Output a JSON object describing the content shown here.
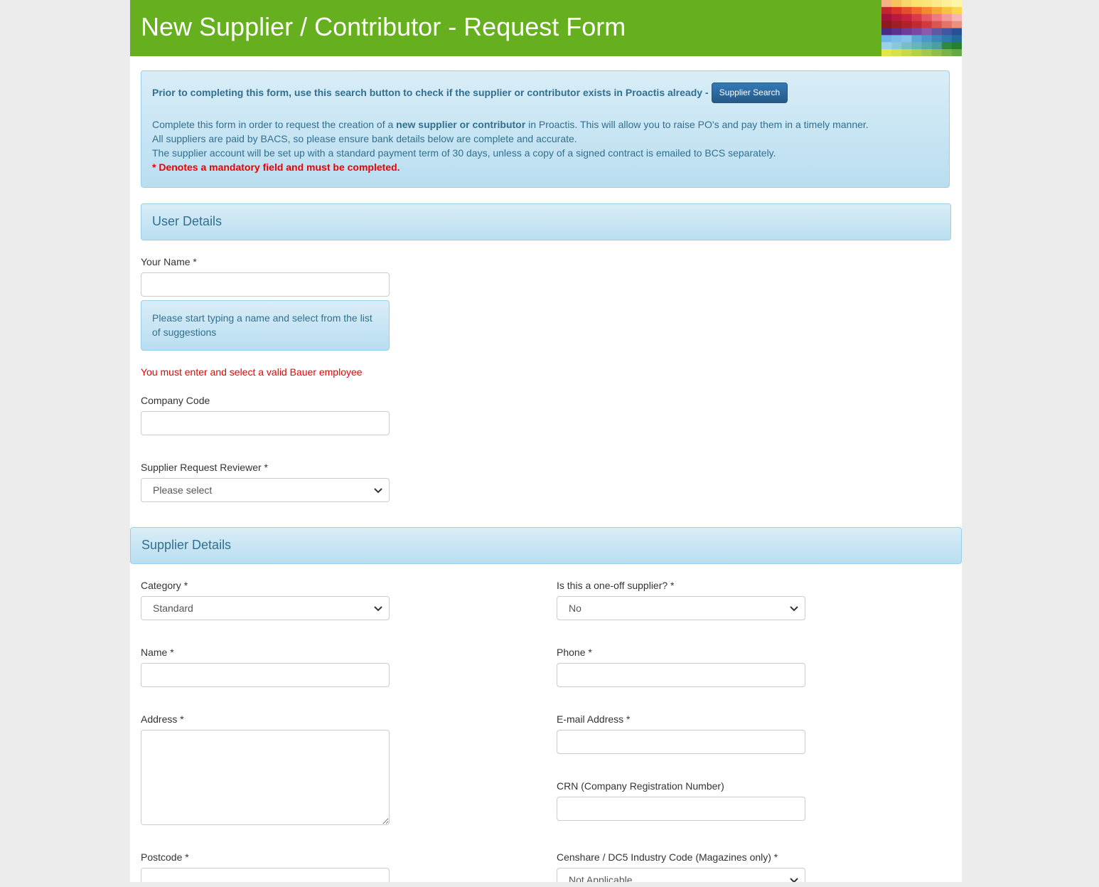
{
  "header": {
    "title": "New Supplier / Contributor - Request Form"
  },
  "info": {
    "prior_text": "Prior to completing this form, use this search button to check if the supplier or contributor exists in Proactis already -",
    "search_button": "Supplier Search",
    "line2_a": "Complete this form in order to request the creation of a ",
    "line2_bold": "new supplier or contributor",
    "line2_b": " in Proactis. This will allow you to raise PO's and pay them in a timely manner.",
    "line3": "All suppliers are paid by BACS, so please ensure bank details below are complete and accurate.",
    "line4": "The supplier account will be set up with a standard payment term of 30 days, unless a copy of a signed contract is emailed to BCS separately.",
    "mandatory": "* Denotes a mandatory field and must be completed."
  },
  "user_details": {
    "heading": "User Details",
    "your_name_label": "Your Name *",
    "your_name_value": "",
    "name_hint": "Please start typing a name and select from the list of suggestions",
    "name_error": "You must enter and select a valid Bauer employee",
    "company_code_label": "Company Code",
    "company_code_value": "",
    "reviewer_label": "Supplier Request Reviewer *",
    "reviewer_value": "Please select"
  },
  "supplier_details": {
    "heading": "Supplier Details",
    "category_label": "Category *",
    "category_value": "Standard",
    "one_off_label": "Is this a one-off supplier? *",
    "one_off_value": "No",
    "name_label": "Name *",
    "phone_label": "Phone *",
    "address_label": "Address *",
    "email_label": "E-mail Address *",
    "crn_label": "CRN (Company Registration Number)",
    "postcode_label": "Postcode *",
    "censhare_label": "Censhare / DC5 Industry Code (Magazines only) *",
    "censhare_value": "Not Applicable"
  },
  "colors": {
    "header_green": "#66af1f",
    "info_text": "#31708f",
    "primary_button": "#337ab7",
    "error_red": "#ee0000"
  }
}
